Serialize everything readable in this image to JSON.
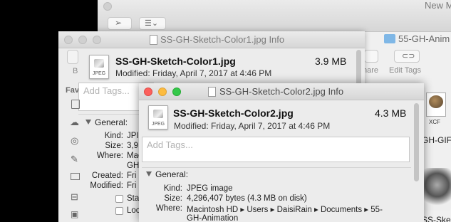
{
  "finder": {
    "title": "New M",
    "folder_name": "55-GH-Anim",
    "share_label": "hare",
    "edit_tags_label": "Edit Tags",
    "favorites_label": "Fav",
    "item_gimp_caption": "XCF",
    "item_gimp_name": "GH-GIF",
    "item_ske_name": "SS-Ske"
  },
  "info1": {
    "window_title": "SS-GH-Sketch-Color1.jpg Info",
    "file_name": "SS-GH-Sketch-Color1.jpg",
    "file_size": "3.9 MB",
    "modified": "Modified: Friday, April 7, 2017 at 4:46 PM",
    "tags_placeholder": "Add Tags...",
    "general_label": "General:",
    "kind_label": "Kind:",
    "kind_value": "JPI",
    "size_label": "Size:",
    "size_value": "3,9",
    "where_label": "Where:",
    "where_value": "Mac",
    "where_value2": "GH-",
    "created_label": "Created:",
    "created_value": "Fri",
    "modified_label": "Modified:",
    "modified_value": "Fri",
    "stationery_label": "Sta",
    "locked_label": "Loc",
    "icon_caption": "JPEG",
    "toolbar_back_label": "B"
  },
  "info2": {
    "window_title": "SS-GH-Sketch-Color2.jpg Info",
    "file_name": "SS-GH-Sketch-Color2.jpg",
    "file_size": "4.3 MB",
    "modified": "Modified: Friday, April 7, 2017 at 4:46 PM",
    "tags_placeholder": "Add Tags...",
    "general_label": "General:",
    "kind_label": "Kind:",
    "kind_value": "JPEG image",
    "size_label": "Size:",
    "size_value": "4,296,407 bytes (4.3 MB on disk)",
    "where_label": "Where:",
    "where_value": "Macintosh HD ▸ Users ▸ DaisiRain ▸ Documents ▸ 55-",
    "where_value2": "GH-Animation",
    "icon_caption": "JPEG"
  }
}
